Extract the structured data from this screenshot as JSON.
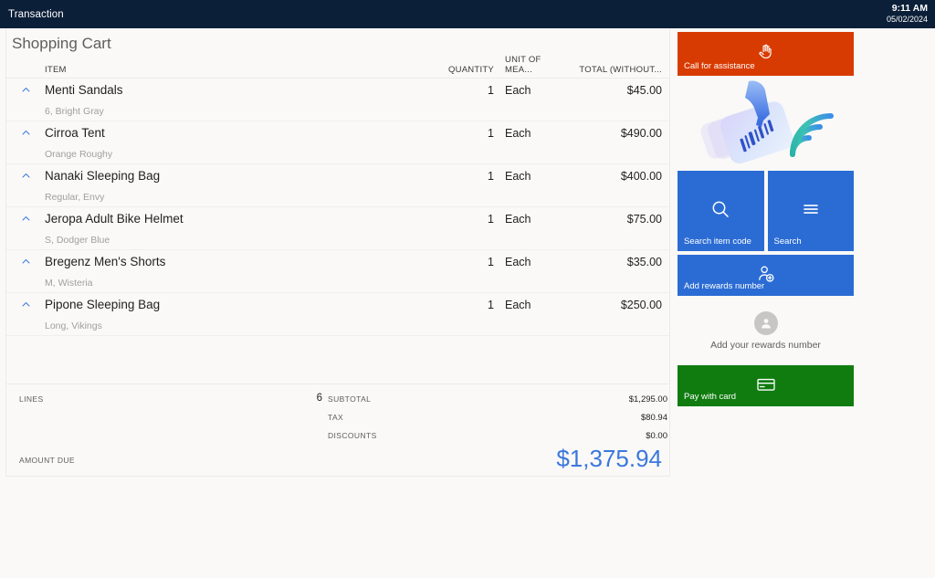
{
  "titlebar": {
    "title": "Transaction",
    "time": "9:11 AM",
    "date": "05/02/2024"
  },
  "cart": {
    "title": "Shopping Cart",
    "columns": {
      "item": "ITEM",
      "quantity": "QUANTITY",
      "unit_of_measure": "UNIT OF MEA...",
      "total": "TOTAL (WITHOUT..."
    },
    "rows": [
      {
        "name": "Menti Sandals",
        "variant": "6, Bright Gray",
        "quantity": "1",
        "unit": "Each",
        "total": "$45.00",
        "expander": "chevron-up-icon"
      },
      {
        "name": "Cirroa Tent",
        "variant": "Orange Roughy",
        "quantity": "1",
        "unit": "Each",
        "total": "$490.00",
        "expander": "chevron-up-icon"
      },
      {
        "name": "Nanaki Sleeping Bag",
        "variant": "Regular, Envy",
        "quantity": "1",
        "unit": "Each",
        "total": "$400.00",
        "expander": "chevron-up-icon"
      },
      {
        "name": "Jeropa Adult Bike Helmet",
        "variant": "S, Dodger Blue",
        "quantity": "1",
        "unit": "Each",
        "total": "$75.00",
        "expander": "chevron-up-icon"
      },
      {
        "name": "Bregenz Men's Shorts",
        "variant": "M, Wisteria",
        "quantity": "1",
        "unit": "Each",
        "total": "$35.00",
        "expander": "chevron-up-icon"
      },
      {
        "name": "Pipone Sleeping Bag",
        "variant": "Long, Vikings",
        "quantity": "1",
        "unit": "Each",
        "total": "$250.00",
        "expander": "chevron-up-icon"
      }
    ],
    "totals": {
      "lines_label": "LINES",
      "lines_value": "6",
      "subtotal_label": "SUBTOTAL",
      "subtotal_value": "$1,295.00",
      "tax_label": "TAX",
      "tax_value": "$80.94",
      "discounts_label": "DISCOUNTS",
      "discounts_value": "$0.00",
      "amount_due_label": "AMOUNT DUE",
      "amount_due_value": "$1,375.94"
    }
  },
  "rail": {
    "call_assistance": {
      "label": "Call for assistance",
      "icon": "raised-hand-icon"
    },
    "tap_illustration": {
      "icon": "tap-to-scan-icon"
    },
    "search_item_code": {
      "label": "Search item code",
      "icon": "search-icon"
    },
    "search": {
      "label": "Search",
      "icon": "hamburger-menu-icon"
    },
    "add_rewards_number": {
      "label": "Add rewards number",
      "icon": "person-add-icon"
    },
    "rewards_prompt": {
      "label": "Add your rewards number",
      "icon": "person-avatar-icon"
    },
    "pay_with_card": {
      "label": "Pay with card",
      "icon": "credit-card-icon"
    }
  },
  "colors": {
    "titlebar": "#0B1F38",
    "accent_orange": "#D83B01",
    "accent_blue": "#2B6CD4",
    "accent_green": "#107C10",
    "amount_due": "#3B78DC",
    "page_bg": "#FAF9F7"
  }
}
